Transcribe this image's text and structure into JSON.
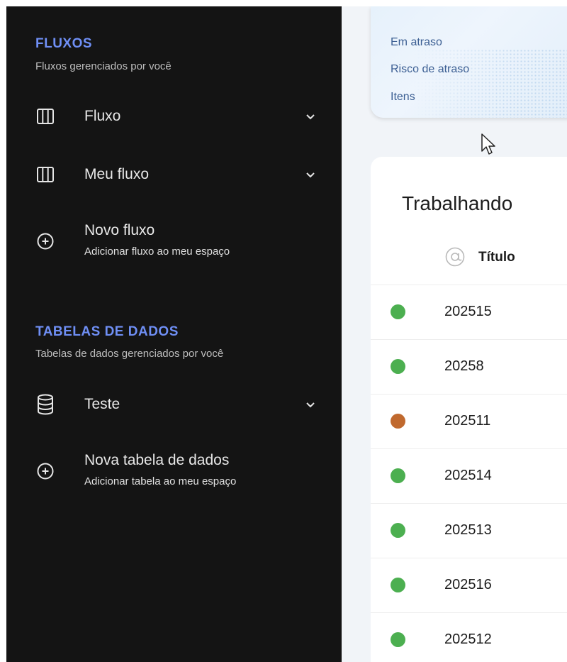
{
  "sidebar": {
    "flows_title": "FLUXOS",
    "flows_subtitle": "Fluxos gerenciados por você",
    "flows": [
      {
        "label": "Fluxo",
        "icon": "kanban-columns-icon"
      },
      {
        "label": "Meu fluxo",
        "icon": "kanban-columns-icon"
      }
    ],
    "new_flow": {
      "label": "Novo fluxo",
      "sublabel": "Adicionar fluxo ao meu espaço",
      "icon": "plus-circle-icon"
    },
    "tables_title": "TABELAS DE DADOS",
    "tables_subtitle": "Tabelas de dados gerenciados por você",
    "tables": [
      {
        "label": "Teste",
        "icon": "database-icon"
      }
    ],
    "new_table": {
      "label": "Nova tabela de dados",
      "sublabel": "Adicionar tabela ao meu espaço",
      "icon": "plus-circle-icon"
    }
  },
  "summary_card": {
    "links": [
      "Em atraso",
      "Risco de atraso",
      "Itens"
    ]
  },
  "work_card": {
    "title": "Trabalhando",
    "column_header": "Título",
    "rows": [
      {
        "id": "202515",
        "status_color": "#4caf50"
      },
      {
        "id": "20258",
        "status_color": "#4caf50"
      },
      {
        "id": "202511",
        "status_color": "#c0692e"
      },
      {
        "id": "202514",
        "status_color": "#4caf50"
      },
      {
        "id": "202513",
        "status_color": "#4caf50"
      },
      {
        "id": "202516",
        "status_color": "#4caf50"
      },
      {
        "id": "202512",
        "status_color": "#4caf50"
      }
    ]
  },
  "colors": {
    "sidebar_bg": "#141414",
    "section_title": "#6f8ff5",
    "link": "#3c5f93"
  }
}
